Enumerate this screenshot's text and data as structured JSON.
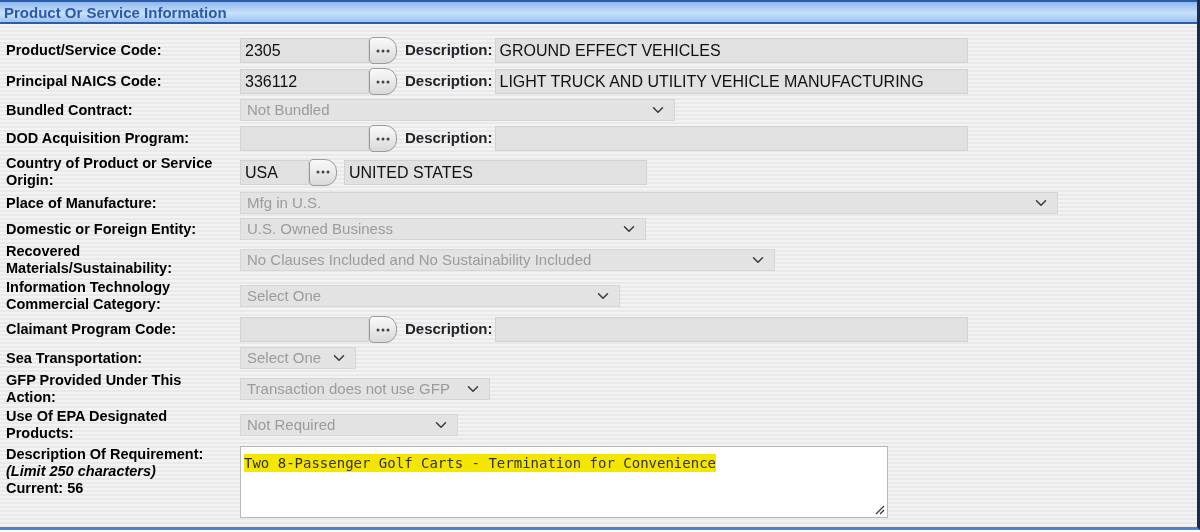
{
  "section": {
    "title": "Product Or Service Information"
  },
  "rows": [
    {
      "kind": "lookup",
      "label": "Product/Service Code:",
      "code": "2305",
      "description_label": "Description:",
      "description": "GROUND EFFECT VEHICLES"
    },
    {
      "kind": "lookup",
      "label": "Principal NAICS Code:",
      "code": "336112",
      "description_label": "Description:",
      "description": "LIGHT TRUCK AND UTILITY VEHICLE MANUFACTURING"
    },
    {
      "kind": "select",
      "label": "Bundled Contract:",
      "value": "Not Bundled",
      "disabled": true
    },
    {
      "kind": "lookup",
      "label": "DOD Acquisition Program:",
      "description_label": "Description:"
    },
    {
      "kind": "country",
      "label": "Country of Product or Service Origin:",
      "code": "USA",
      "description": "UNITED STATES"
    },
    {
      "kind": "select",
      "label": "Place of Manufacture:",
      "value": "Mfg in U.S.",
      "disabled": true
    },
    {
      "kind": "select",
      "label": "Domestic or Foreign Entity:",
      "value": "U.S. Owned Business",
      "disabled": true
    },
    {
      "kind": "select",
      "label": "Recovered Materials/Sustainability:",
      "value": "No Clauses Included and No Sustainability Included",
      "disabled": true
    },
    {
      "kind": "select",
      "label": "Information Technology Commercial Category:",
      "value": "Select One",
      "disabled": true
    },
    {
      "kind": "lookup",
      "label": "Claimant Program Code:",
      "description_label": "Description:"
    },
    {
      "kind": "select",
      "label": "Sea Transportation:",
      "value": "Select One",
      "disabled": true
    },
    {
      "kind": "select",
      "label": "GFP Provided Under This Action:",
      "value": "Transaction does not use GFP",
      "disabled": true
    },
    {
      "kind": "select",
      "label": "Use Of EPA Designated Products:",
      "value": "Not Required",
      "disabled": true
    },
    {
      "kind": "textarea",
      "label": "Description Of Requirement:",
      "note": "(Limit 250 characters)",
      "counter": "Current: 56",
      "value": "Two 8-Passenger Golf Carts - Termination for Convenience",
      "highlighted": true
    }
  ]
}
